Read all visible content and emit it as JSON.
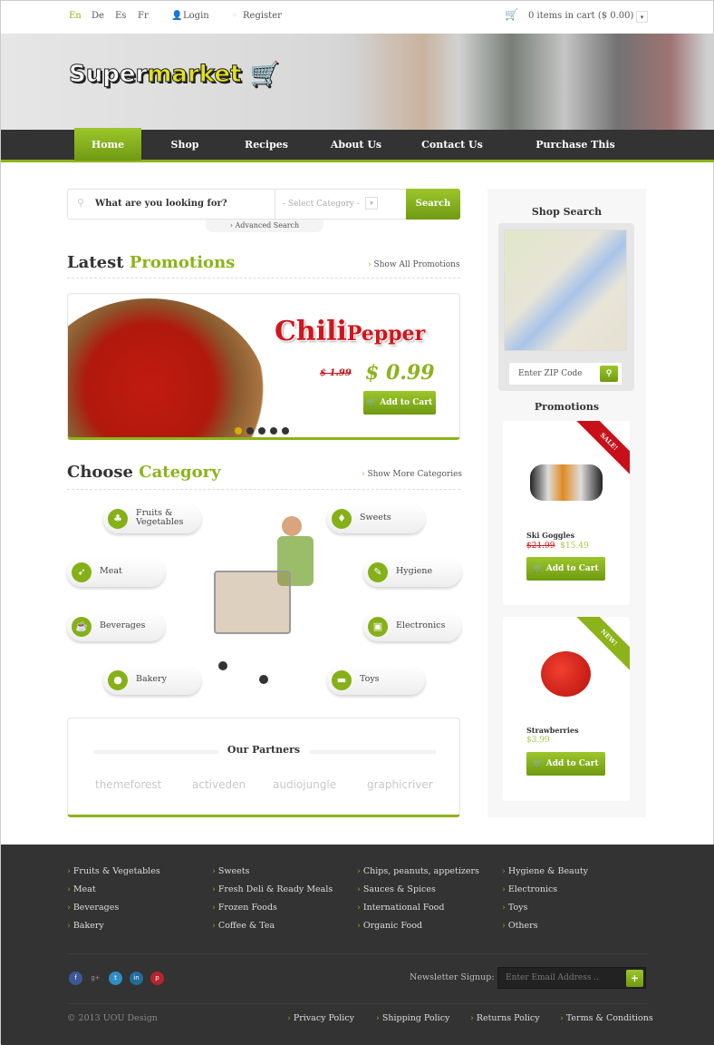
{
  "topbar": {
    "languages": [
      "En",
      "De",
      "Es",
      "Fr"
    ],
    "login": "Login",
    "register": "Register",
    "cart": "0 items in cart ($ 0.00)"
  },
  "logo": {
    "part1": "Super",
    "part2": "market"
  },
  "nav": [
    "Home",
    "Shop",
    "Recipes",
    "About Us",
    "Contact Us",
    "Purchase This Theme"
  ],
  "search": {
    "placeholder": "What are you looking for?",
    "category": "- Select Category -",
    "button": "Search",
    "advanced": "Advanced Search"
  },
  "promotions": {
    "title1": "Latest",
    "title2": "Promotions",
    "show_all": "Show All Promotions",
    "product1": "Chili",
    "product2": "Pepper",
    "old_price": "$ 1.99",
    "price": "$ 0.99",
    "add": "Add to Cart",
    "slides": 5,
    "active_slide": 1
  },
  "categories": {
    "title1": "Choose",
    "title2": "Category",
    "show_more": "Show More Categories",
    "items": [
      "Fruits & Vegetables",
      "Sweets",
      "Meat",
      "Hygiene",
      "Beverages",
      "Electronics",
      "Bakery",
      "Toys"
    ]
  },
  "partners": {
    "title": "Our Partners",
    "items": [
      "themeforest",
      "activeden",
      "audiojungle",
      "graphicriver"
    ]
  },
  "sidebar": {
    "shop_search": "Shop Search",
    "zip_placeholder": "Enter ZIP Code",
    "promotions": "Promotions",
    "cards": [
      {
        "ribbon": "SALE!",
        "ribbon_color": "#c8101a",
        "name": "Ski Goggles",
        "old_price": "$21.99",
        "price": "$15.49",
        "add": "Add to Cart"
      },
      {
        "ribbon": "NEW!",
        "ribbon_color": "#8cb319",
        "name": "Strawberries",
        "price": "$3.99",
        "add": "Add to Cart"
      }
    ]
  },
  "footer": {
    "columns": [
      [
        "Fruits & Vegetables",
        "Meat",
        "Beverages",
        "Bakery"
      ],
      [
        "Sweets",
        "Fresh Deli & Ready Meals",
        "Frozen Foods",
        "Coffee & Tea"
      ],
      [
        "Chips, peanuts, appetizers",
        "Sauces & Spices",
        "International Food",
        "Organic Food"
      ],
      [
        "Hygiene & Beauty",
        "Electronics",
        "Toys",
        "Others"
      ]
    ],
    "newsletter": "Newsletter Signup:",
    "email_placeholder": "Enter Email Address ..",
    "plus": "+",
    "copyright": "© 2013 UOU Design",
    "links": [
      "Privacy Policy",
      "Shipping Policy",
      "Returns Policy",
      "Terms & Conditions"
    ],
    "social": [
      "f",
      "g+",
      "t",
      "in",
      "p"
    ]
  },
  "colors": {
    "accent": "#8cb319",
    "dark": "#333333",
    "sale": "#c8101a"
  }
}
